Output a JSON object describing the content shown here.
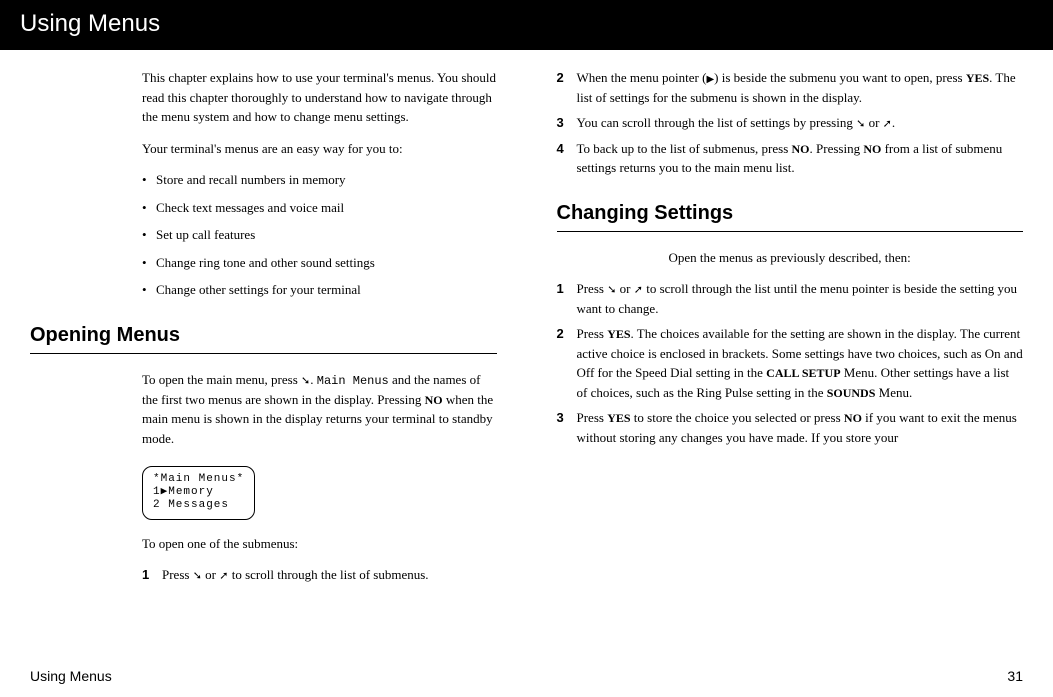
{
  "header": "Using Menus",
  "col1": {
    "intro": "This chapter explains how to use your terminal's menus. You should read this chapter thoroughly to understand how to navigate through the menu system and how to change menu settings.",
    "lead": "Your terminal's menus are an easy way for you to:",
    "bullets": [
      "Store and recall numbers in memory",
      "Check text messages and voice mail",
      "Set up call features",
      "Change ring tone and other sound settings",
      "Change other settings for your terminal"
    ],
    "opening_heading": "Opening Menus",
    "opening_p1a": "To open the main menu, press ",
    "opening_p1b": ". ",
    "opening_p1c": " and the names of the first two menus are shown in the display. Pressing ",
    "opening_p1d": " when the main menu is shown in the display returns your terminal to standby mode.",
    "main_menus_mono": "Main Menus",
    "no_label": "NO",
    "display_line1": "*Main Menus*",
    "display_line2": "1▶Memory",
    "display_line3": "2 Messages",
    "submenu_lead": "To open one of the submenus:",
    "step1_num": "1",
    "step1a": "Press ",
    "step1b": " or ",
    "step1c": " to scroll through the list of submenus."
  },
  "col2": {
    "step2_num": "2",
    "step2a": "When the menu pointer (",
    "step2b": ") is beside the submenu you want to open, press ",
    "step2c": ".  The list of settings for the submenu is shown in the display.",
    "yes_label": "YES",
    "step3_num": "3",
    "step3a": "You can scroll through the list of settings by pressing ",
    "step3b": " or ",
    "step3c": ".",
    "step4_num": "4",
    "step4a": "To back up to the list of submenus, press ",
    "step4b": ". Pressing ",
    "step4c": " from a list of submenu settings returns you to the main menu list.",
    "no_label": "NO",
    "changing_heading": "Changing Settings",
    "changing_lead": "Open the menus as previously described, then:",
    "c1_num": "1",
    "c1a": "Press ",
    "c1b": " or ",
    "c1c": " to scroll through the list until the menu pointer is beside the setting you want to change.",
    "c2_num": "2",
    "c2a": "Press ",
    "c2b": ".  The choices available for the setting are shown in the display.  The current active choice is enclosed in brackets.  Some settings have two choices, such as On and Off for the Speed Dial setting in the ",
    "c2c": " Menu.  Other settings have a list of choices, such as the Ring Pulse setting in the ",
    "c2d": " Menu.",
    "call_setup": "CALL SETUP",
    "sounds": "SOUNDS",
    "c3_num": "3",
    "c3a": "Press  ",
    "c3b": " to store the choice you selected or press ",
    "c3c": " if you want to exit the menus without storing any changes you have made.  If you store your"
  },
  "footer": {
    "left": "Using Menus",
    "right": "31"
  }
}
